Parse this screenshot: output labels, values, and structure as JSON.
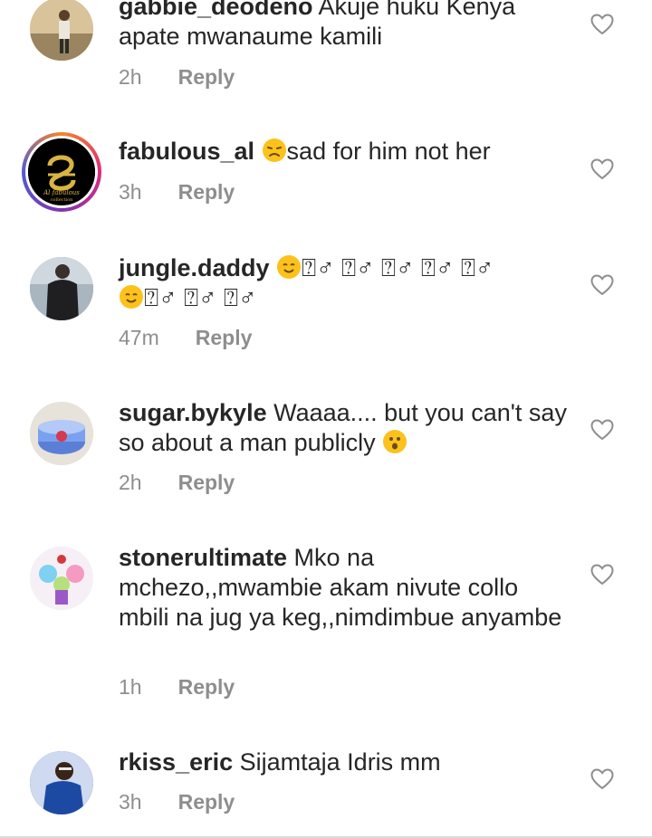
{
  "comments": [
    {
      "username": "gabbie_deodeno",
      "text": " Akuje huku Kenya apate mwanaume kamili",
      "time": "2h",
      "reply": "Reply",
      "avatar": "avatar-person-outdoor",
      "like_icon": "heart-outline-icon"
    },
    {
      "username": "fabulous_al",
      "emoji_prefix": "worried-face-emoji",
      "text": "sad for him not her",
      "time": "3h",
      "reply": "Reply",
      "avatar": "avatar-fabulous-collection-logo",
      "avatar_logo_text": "Al fabulous",
      "avatar_logo_subtext": "collection",
      "like_icon": "heart-outline-icon"
    },
    {
      "username": "jungle.daddy",
      "text_line1": "⍰♂ ⍰♂ ⍰♂ ⍰♂ ⍰♂",
      "text_line2": "⍰♂ ⍰♂ ⍰♂",
      "emoji_name": "smiling-face-emoji",
      "time": "47m",
      "reply": "Reply",
      "avatar": "avatar-person-dark-suit",
      "like_icon": "heart-outline-icon"
    },
    {
      "username": "sugar.bykyle",
      "text": " Waaaa.... but you can't say so about a man publicly ",
      "emoji_suffix": "hushed-face-emoji",
      "time": "2h",
      "reply": "Reply",
      "avatar": "avatar-cake",
      "like_icon": "heart-outline-icon"
    },
    {
      "username": "stonerultimate",
      "text": " Mko na mchezo,,mwambie akam nivute collo mbili na jug ya keg,,nimdimbue anyambe",
      "time": "1h",
      "reply": "Reply",
      "avatar": "avatar-cartoon",
      "like_icon": "heart-outline-icon"
    },
    {
      "username": "rkiss_eric",
      "text": " Sijamtaja Idris mm",
      "time": "3h",
      "reply": "Reply",
      "avatar": "avatar-person-blue",
      "like_icon": "heart-outline-icon"
    }
  ],
  "colors": {
    "text": "#262626",
    "secondary": "#8e8e8e",
    "background": "#ffffff"
  }
}
